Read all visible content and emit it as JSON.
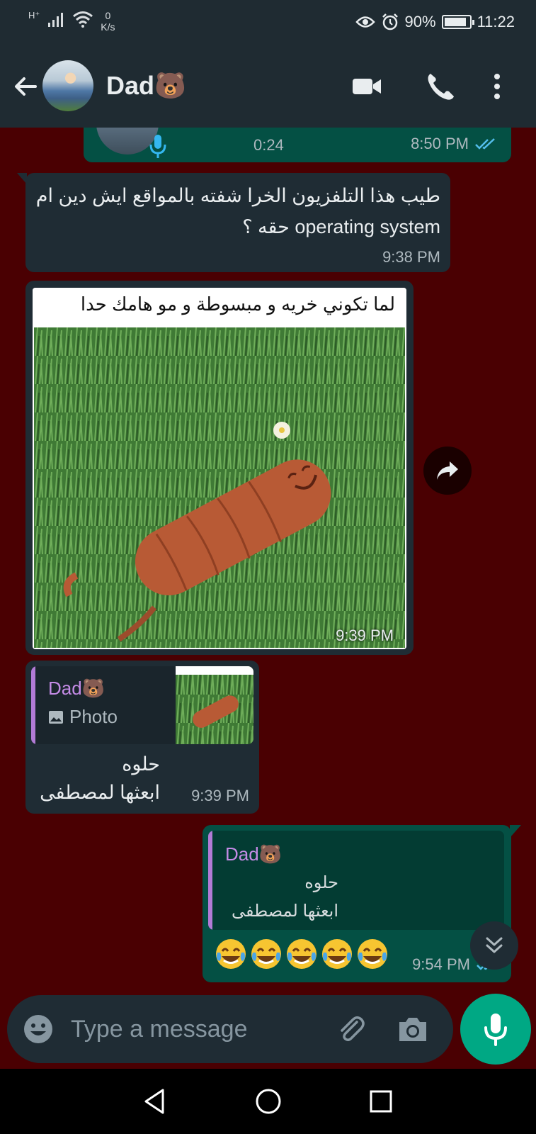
{
  "status_bar": {
    "network": "H⁺",
    "speed_value": "0",
    "speed_unit": "K/s",
    "battery": "90%",
    "battery_level": 0.9,
    "time": "11:22"
  },
  "header": {
    "contact_name": "Dad🐻"
  },
  "messages": {
    "voice": {
      "duration": "0:24",
      "time": "8:50 PM"
    },
    "text1": {
      "text": "طيب هذا التلفزيون الخرا شفته بالمواقع ايش دين ام operating system حقه ؟",
      "time": "9:38 PM"
    },
    "image": {
      "caption": "لما تكوني خريه و مبسوطة و مو هامك حدا",
      "time": "9:39 PM"
    },
    "reply_in": {
      "quote_name": "Dad🐻",
      "quote_type": "Photo",
      "line1": "حلوه",
      "line2": "ابعثها لمصطفى",
      "time": "9:39 PM"
    },
    "reply_out": {
      "quote_name": "Dad🐻",
      "quote_line1": "حلوه",
      "quote_line2": "ابعثها لمصطفى",
      "time": "9:54 PM"
    }
  },
  "composer": {
    "placeholder": "Type a message"
  },
  "colors": {
    "wallpaper": "#4a0002",
    "incoming": "#1f2c34",
    "outgoing": "#045044",
    "accent": "#00a884",
    "read_ticks": "#53bdeb",
    "quote_name": "#c48be6"
  },
  "icons": [
    "signal-icon",
    "wifi-icon",
    "eye-icon",
    "alarm-icon",
    "battery-icon",
    "back-arrow-icon",
    "video-call-icon",
    "phone-icon",
    "more-vert-icon",
    "mic-icon",
    "double-check-icon",
    "forward-icon",
    "photo-icon",
    "laughing-emoji-icon",
    "chevron-double-down-icon",
    "emoji-icon",
    "paperclip-icon",
    "camera-icon",
    "nav-back-icon",
    "nav-home-icon",
    "nav-recents-icon"
  ]
}
